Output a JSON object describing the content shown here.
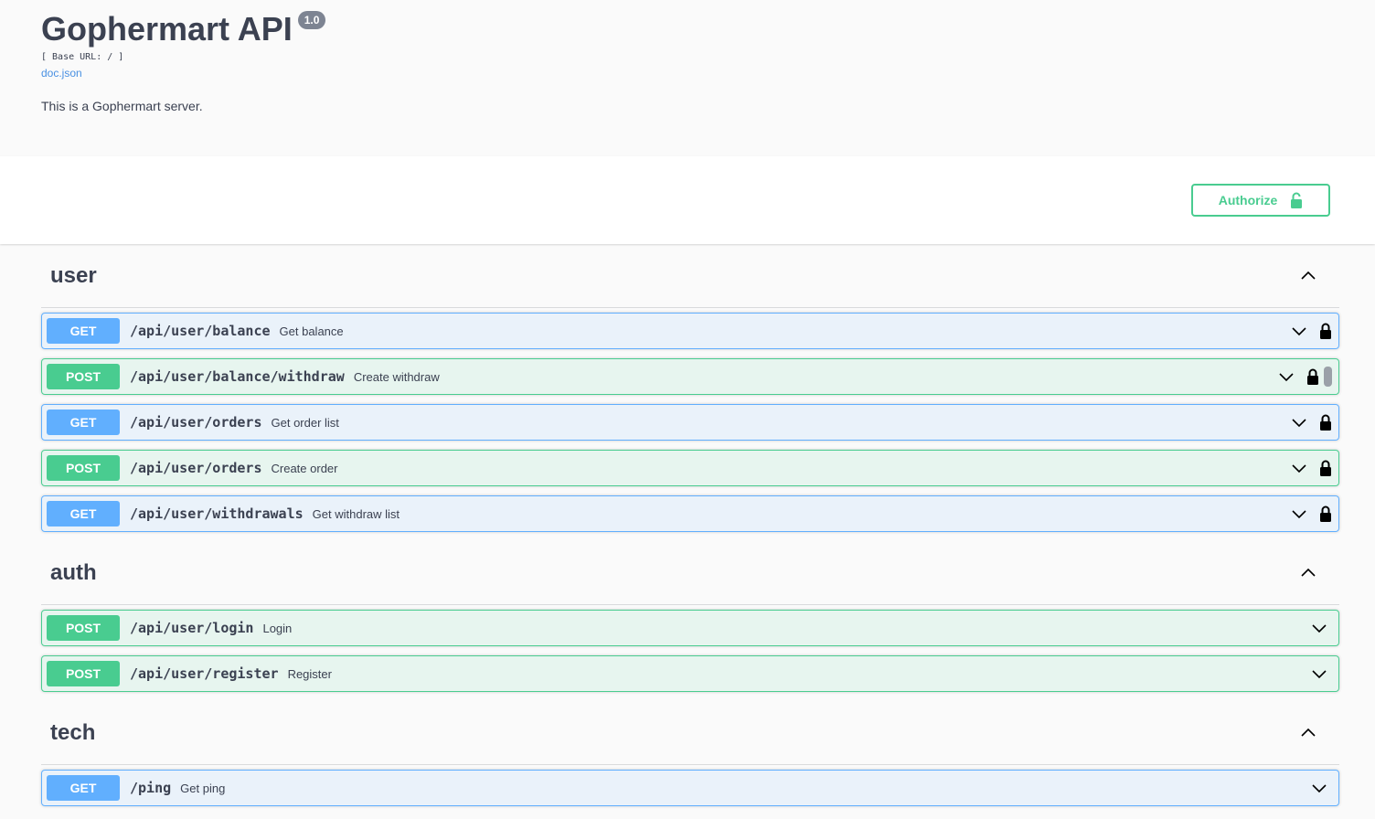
{
  "info": {
    "title": "Gophermart API",
    "version": "1.0",
    "base_url": "[ Base URL: / ]",
    "doc_link": "doc.json",
    "description": "This is a Gophermart server."
  },
  "authorize": {
    "label": "Authorize"
  },
  "colors": {
    "get": "#61affe",
    "post": "#49cc90",
    "text": "#3b4151",
    "link": "#4990e2"
  },
  "tags": [
    {
      "name": "user",
      "operations": [
        {
          "method": "GET",
          "path": "/api/user/balance",
          "summary": "Get balance",
          "locked": true
        },
        {
          "method": "POST",
          "path": "/api/user/balance/withdraw",
          "summary": "Create withdraw",
          "locked": true
        },
        {
          "method": "GET",
          "path": "/api/user/orders",
          "summary": "Get order list",
          "locked": true
        },
        {
          "method": "POST",
          "path": "/api/user/orders",
          "summary": "Create order",
          "locked": true
        },
        {
          "method": "GET",
          "path": "/api/user/withdrawals",
          "summary": "Get withdraw list",
          "locked": true
        }
      ]
    },
    {
      "name": "auth",
      "operations": [
        {
          "method": "POST",
          "path": "/api/user/login",
          "summary": "Login",
          "locked": false
        },
        {
          "method": "POST",
          "path": "/api/user/register",
          "summary": "Register",
          "locked": false
        }
      ]
    },
    {
      "name": "tech",
      "operations": [
        {
          "method": "GET",
          "path": "/ping",
          "summary": "Get ping",
          "locked": false
        }
      ]
    }
  ]
}
